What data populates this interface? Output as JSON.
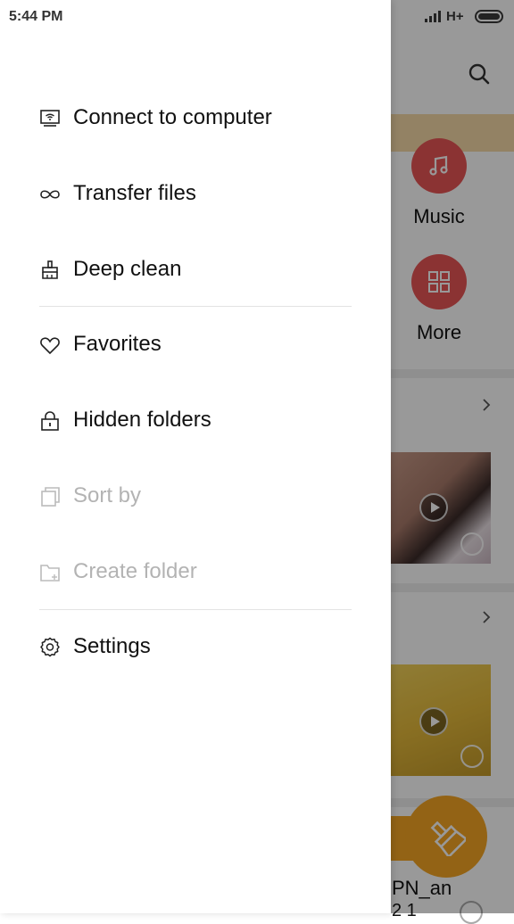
{
  "status_bar": {
    "time": "5:44 PM",
    "network": "H+"
  },
  "drawer": {
    "items": [
      {
        "label": "Connect to computer",
        "icon": "computer-wifi-icon",
        "enabled": true
      },
      {
        "label": "Transfer files",
        "icon": "infinity-icon",
        "enabled": true
      },
      {
        "label": "Deep clean",
        "icon": "brush-icon",
        "enabled": true
      },
      {
        "label": "Favorites",
        "icon": "heart-icon",
        "enabled": true
      },
      {
        "label": "Hidden folders",
        "icon": "lock-icon",
        "enabled": true
      },
      {
        "label": "Sort by",
        "icon": "sort-icon",
        "enabled": false
      },
      {
        "label": "Create folder",
        "icon": "folder-add-icon",
        "enabled": false
      },
      {
        "label": "Settings",
        "icon": "gear-icon",
        "enabled": true
      }
    ]
  },
  "background": {
    "categories": [
      {
        "label": "Music",
        "icon": "music-note-icon"
      },
      {
        "label": "More",
        "icon": "grid-icon"
      }
    ],
    "file_name_partial": "PN_an",
    "file_name_partial_2": "2 1",
    "colors": {
      "category_red": "#e85555",
      "fab_orange": "#f5a623",
      "banner": "#f6d9a7",
      "disabled_text": "#b3b3b3"
    }
  }
}
